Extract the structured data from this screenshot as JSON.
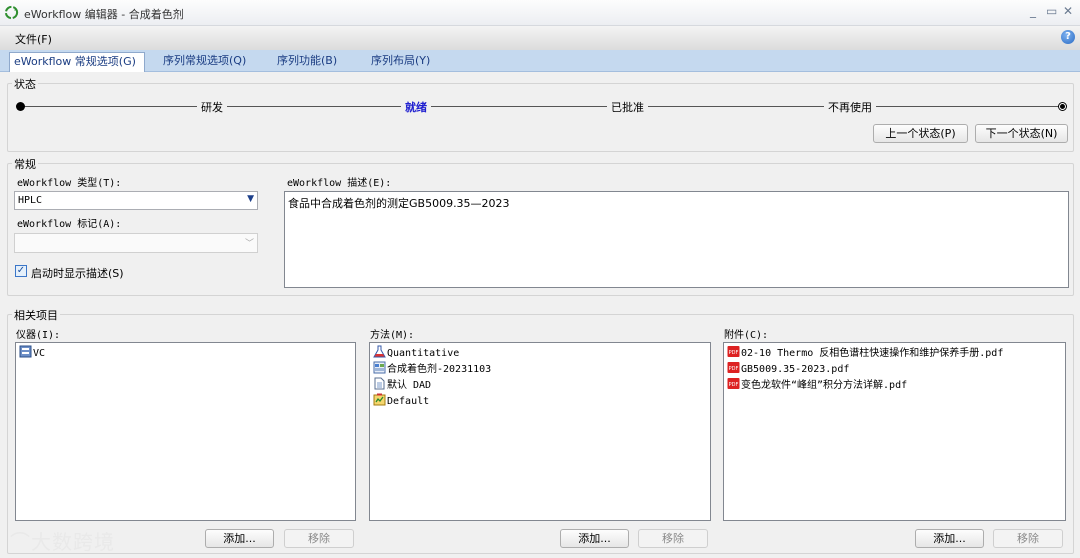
{
  "window": {
    "title": "eWorkflow 编辑器 - 合成着色剂",
    "minimize": "_",
    "maximize": "▭",
    "close": "✕"
  },
  "menu": {
    "file": "文件(F)",
    "help": "?"
  },
  "tabs": [
    {
      "label": "eWorkflow 常规选项(G)",
      "active": true
    },
    {
      "label": "序列常规选项(Q)",
      "active": false
    },
    {
      "label": "序列功能(B)",
      "active": false
    },
    {
      "label": "序列布局(Y)",
      "active": false
    }
  ],
  "status": {
    "title": "状态",
    "stages": [
      "研发",
      "就绪",
      "已批准",
      "不再使用"
    ],
    "current": "就绪",
    "prev_button": "上一个状态(P)",
    "next_button": "下一个状态(N)"
  },
  "general": {
    "title": "常规",
    "type_label": "eWorkflow 类型(T):",
    "type_value": "HPLC",
    "tag_label": "eWorkflow 标记(A):",
    "tag_value": "",
    "show_desc_label": "启动时显示描述(S)",
    "show_desc_checked": true,
    "desc_label": "eWorkflow 描述(E):",
    "desc_value": "食品中合成着色剂的测定GB5009.35—2023"
  },
  "related": {
    "title": "相关项目",
    "instruments": {
      "label": "仪器(I):",
      "items": [
        {
          "name": "VC",
          "icon": "instrument-icon"
        }
      ]
    },
    "methods": {
      "label": "方法(M):",
      "items": [
        {
          "name": "Quantitative",
          "icon": "flask-icon"
        },
        {
          "name": "合成着色剂-20231103",
          "icon": "method-icon"
        },
        {
          "name": "默认 DAD",
          "icon": "document-icon"
        },
        {
          "name": "Default",
          "icon": "report-icon"
        }
      ]
    },
    "attachments": {
      "label": "附件(C):",
      "items": [
        {
          "name": "02-10 Thermo 反相色谱柱快速操作和维护保养手册.pdf",
          "icon": "pdf-icon"
        },
        {
          "name": "GB5009.35-2023.pdf",
          "icon": "pdf-icon"
        },
        {
          "name": "变色龙软件“峰组”积分方法详解.pdf",
          "icon": "pdf-icon"
        }
      ]
    },
    "add_button": "添加...",
    "remove_button": "移除"
  },
  "watermark": "大数跨境",
  "colors": {
    "accent": "#2020d0",
    "tab_bar": "#c5d9ef",
    "tab_text": "#1a3c82"
  }
}
